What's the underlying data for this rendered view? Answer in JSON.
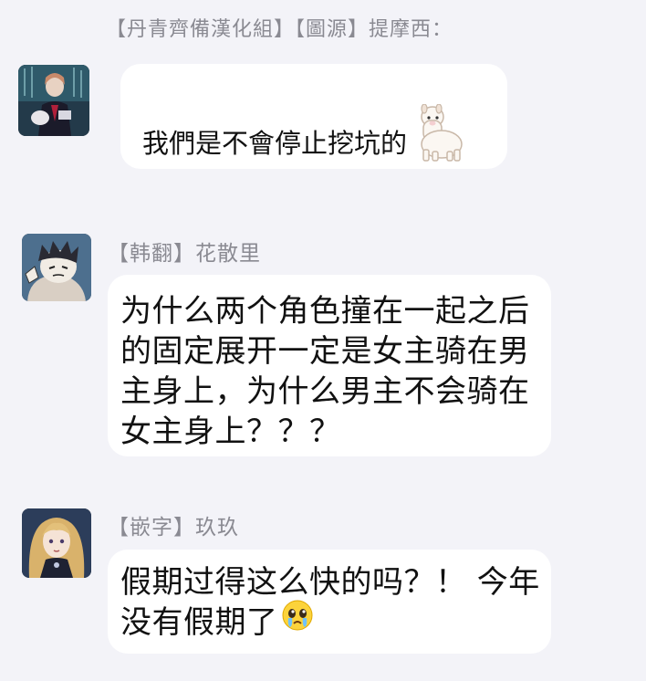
{
  "messages": [
    {
      "sender": "【丹青齊備漢化組】【圖源】提摩西：",
      "text": "我們是不會停止挖坑的",
      "emoji": "alpaca-emoji",
      "avatar": "dark-forest-avatar"
    },
    {
      "sender": "【韩翻】花散里",
      "text": "为什么两个角色撞在一起之后\n的固定展开一定是女主骑在男\n主身上，为什么男主不会骑在\n女主身上？？？",
      "avatar": "sketch-boy-avatar"
    },
    {
      "sender": "【嵌字】玖玖",
      "text": "假期过得这么快的吗？！ 今年\n没有假期了",
      "emoji": "crying-face-emoji",
      "avatar": "blonde-girl-avatar"
    }
  ],
  "colors": {
    "background": "#f3f3f8",
    "bubble": "#ffffff",
    "sender_text": "#8a8a92",
    "message_text": "#111111"
  }
}
